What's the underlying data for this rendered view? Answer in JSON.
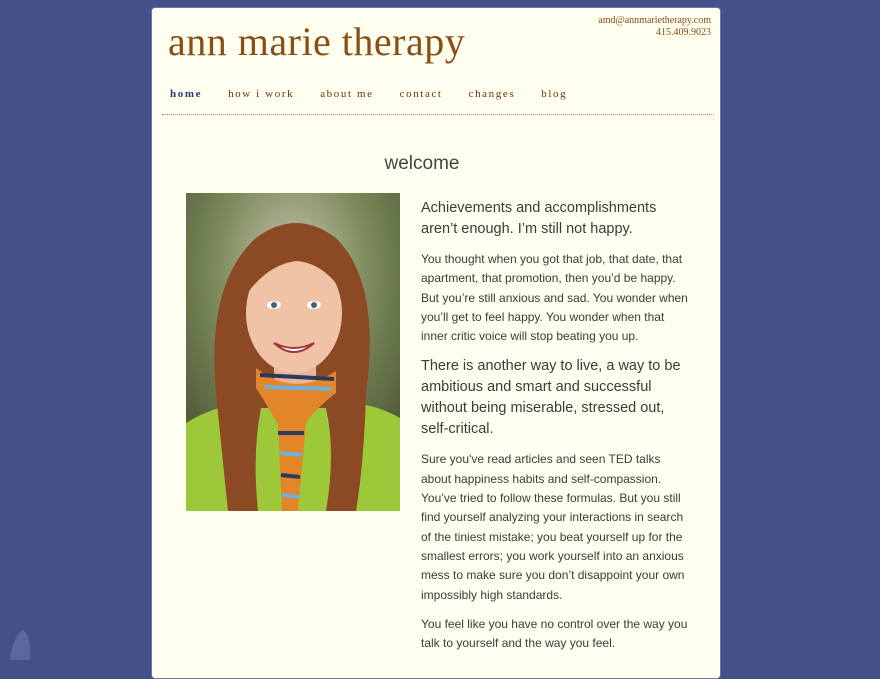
{
  "header": {
    "email": "amd@annmarietherapy.com",
    "phone": "415.409.9023",
    "logo": "ann marie therapy"
  },
  "nav": {
    "items": [
      {
        "label": "home",
        "active": true
      },
      {
        "label": "how i work",
        "active": false
      },
      {
        "label": "about me",
        "active": false
      },
      {
        "label": "contact",
        "active": false
      },
      {
        "label": "changes",
        "active": false
      },
      {
        "label": "blog",
        "active": false
      }
    ]
  },
  "main": {
    "title": "welcome",
    "lead1": "Achievements and accomplishments aren’t enough.  I’m still not happy.",
    "p1": "You thought when you got that job, that date, that apartment, that promotion, then you’d be happy. But you’re still anxious and sad. You wonder when you’ll get to feel happy. You wonder when that inner critic voice will stop beating you up.",
    "lead2": "There is another way to live, a way to be ambitious and smart and successful without being miserable, stressed out, self-critical.",
    "p2": "Sure you've read articles and seen TED talks about happiness habits and self-compassion. You’ve tried to follow these formulas. But you still find yourself analyzing your interactions in search of the tiniest mistake; you beat yourself up for the smallest errors; you work yourself into an anxious mess to make sure you don’t disappoint your own impossibly high standards.",
    "p3": "You feel like you have no control over the way you talk to yourself and the way you feel."
  },
  "colors": {
    "background": "#43508a",
    "page": "#fffff0",
    "brand": "#8b4e14",
    "nav_active": "#2a3a7a"
  }
}
